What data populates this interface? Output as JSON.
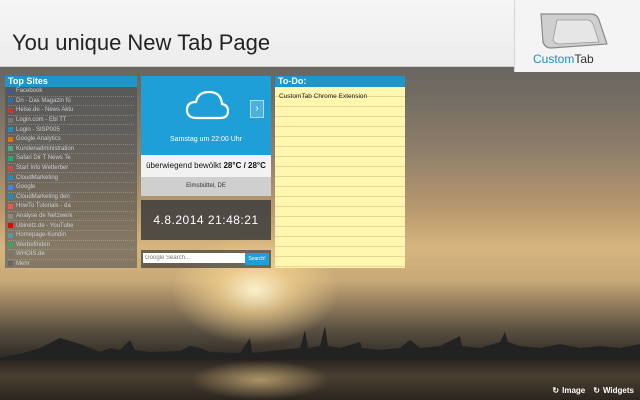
{
  "header": {
    "title": "You unique New Tab Page",
    "logo_part1": "Custom",
    "logo_part2": "Tab"
  },
  "top_sites": {
    "title": "Top Sites",
    "items": [
      "Facebook",
      "Dn - Das Magazin fü",
      "Heise.de - News Aktu",
      "Login.com - Ebl TT",
      "Login - SISP005",
      "Google Analytics",
      "Kundenadministration",
      "Safari Dir T News Te",
      "Start Info Wetterber",
      "CloudMarketing",
      "Google",
      "CloudMarketing den",
      "HowTo Tutorials - da",
      "Analyse de Netzwerk",
      "Ubinetz.de - YouTube",
      "Homepage-Kundin",
      "Werbefinden",
      "WHOIS.de",
      "Mehr"
    ],
    "fav_colors": [
      "#3b5998",
      "#2d6fb5",
      "#c33",
      "#777",
      "#1a8fc6",
      "#e37400",
      "#4a8",
      "#2a7",
      "#d44",
      "#1a8fc6",
      "#4285f4",
      "#1a8fc6",
      "#e55",
      "#888",
      "#e00",
      "#59a",
      "#3a6",
      "#777",
      "#666"
    ]
  },
  "weather": {
    "date": "Samstag um 22:00 Uhr",
    "condition": "überwiegend bewölkt ",
    "temperature": "28°C / 28°C",
    "location": "Elmsbüttel, DE",
    "next_icon": "chevron-right-icon",
    "weather_icon": "cloud-icon"
  },
  "clock": {
    "datetime": "4.8.2014 21:48:21"
  },
  "search": {
    "placeholder": "Google Search...",
    "button_label": "Search!"
  },
  "todo": {
    "title": "To-Do:",
    "items": [
      "CustomTab Chrome Extension"
    ]
  },
  "footer": {
    "image_label": "Image",
    "widgets_label": "Widgets",
    "refresh_icon": "refresh-icon"
  },
  "colors": {
    "accent": "#1f96c9",
    "weather_bg": "#1e9fd8",
    "todo_bg": "#fff6b0"
  }
}
